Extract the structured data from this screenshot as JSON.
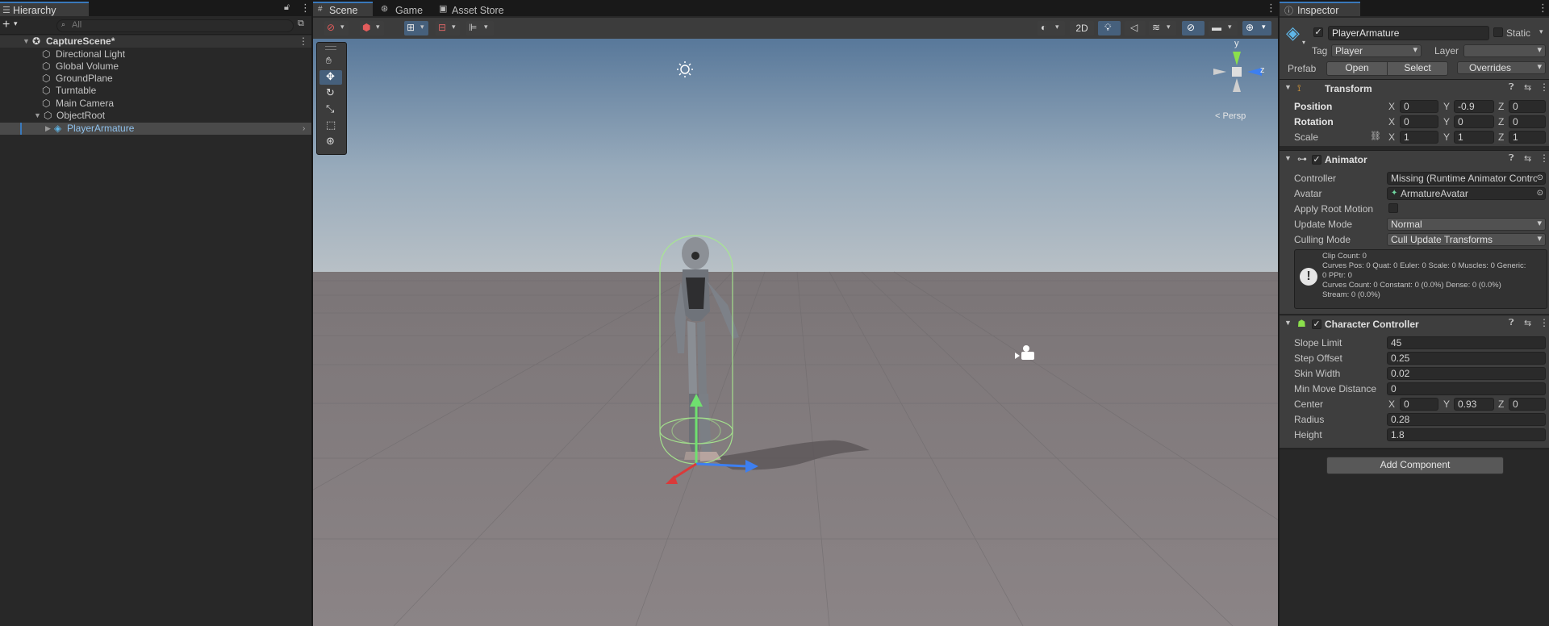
{
  "hierarchy": {
    "tab_label": "Hierarchy",
    "search_placeholder": "All",
    "items": [
      {
        "label": "CaptureScene*"
      },
      {
        "label": "Directional Light"
      },
      {
        "label": "Global Volume"
      },
      {
        "label": "GroundPlane"
      },
      {
        "label": "Turntable"
      },
      {
        "label": "Main Camera"
      },
      {
        "label": "ObjectRoot"
      },
      {
        "label": "PlayerArmature"
      }
    ]
  },
  "scene": {
    "tabs": [
      {
        "label": "Scene"
      },
      {
        "label": "Game"
      },
      {
        "label": "Asset Store"
      }
    ],
    "toolbar": {
      "mode_2d_label": "2D"
    },
    "gizmo": {
      "y_label": "y",
      "z_label": "z",
      "persp_label": "< Persp"
    }
  },
  "inspector": {
    "tab_label": "Inspector",
    "object_name": "PlayerArmature",
    "static_label": "Static",
    "tag_label": "Tag",
    "tag_value": "Player",
    "layer_label": "Layer",
    "layer_value": "",
    "prefab_label": "Prefab",
    "open_label": "Open",
    "select_label": "Select",
    "overrides_label": "Overrides",
    "transform": {
      "title": "Transform",
      "position_label": "Position",
      "position": {
        "x": "0",
        "y": "-0.9",
        "z": "0"
      },
      "rotation_label": "Rotation",
      "rotation": {
        "x": "0",
        "y": "0",
        "z": "0"
      },
      "scale_label": "Scale",
      "scale": {
        "x": "1",
        "y": "1",
        "z": "1"
      }
    },
    "animator": {
      "title": "Animator",
      "controller_label": "Controller",
      "controller_value": "Missing (Runtime Animator Contro",
      "avatar_label": "Avatar",
      "avatar_value": "ArmatureAvatar",
      "apply_root_motion_label": "Apply Root Motion",
      "update_mode_label": "Update Mode",
      "update_mode_value": "Normal",
      "culling_mode_label": "Culling Mode",
      "culling_mode_value": "Cull Update Transforms",
      "info_lines": [
        "Clip Count: 0",
        "Curves Pos: 0 Quat: 0 Euler: 0 Scale: 0 Muscles: 0 Generic:",
        "0 PPtr: 0",
        "Curves Count: 0 Constant: 0 (0.0%) Dense: 0 (0.0%)",
        "Stream: 0 (0.0%)"
      ]
    },
    "character_controller": {
      "title": "Character Controller",
      "slope_limit_label": "Slope Limit",
      "slope_limit": "45",
      "step_offset_label": "Step Offset",
      "step_offset": "0.25",
      "skin_width_label": "Skin Width",
      "skin_width": "0.02",
      "min_move_label": "Min Move Distance",
      "min_move": "0",
      "center_label": "Center",
      "center": {
        "x": "0",
        "y": "0.93",
        "z": "0"
      },
      "radius_label": "Radius",
      "radius": "0.28",
      "height_label": "Height",
      "height": "1.8"
    },
    "add_component_label": "Add Component",
    "axis_x": "X",
    "axis_y": "Y",
    "axis_z": "Z"
  }
}
